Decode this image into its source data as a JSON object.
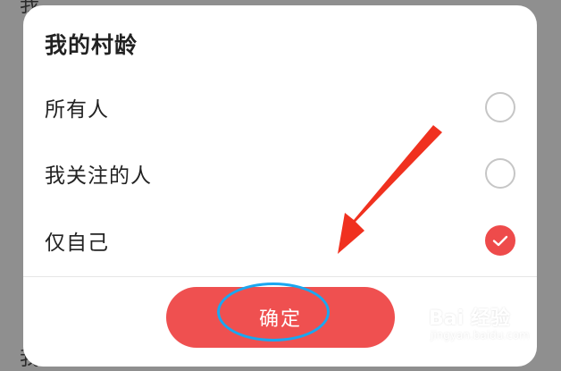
{
  "background": {
    "top_text": "我",
    "bottom_text": "我的作本候顾紧"
  },
  "dialog": {
    "title": "我的村龄",
    "options": [
      {
        "label": "所有人",
        "selected": false
      },
      {
        "label": "我关注的人",
        "selected": false
      },
      {
        "label": "仅自己",
        "selected": true
      }
    ],
    "confirm_label": "确定"
  },
  "annotations": {
    "arrow_color": "#f0311f",
    "circle_color": "#1aa7f0",
    "arrow_target": "confirm-button"
  },
  "watermark": {
    "text": "Bai 经验",
    "sub_text": "jingyan.baidu.com"
  },
  "colors": {
    "accent": "#ef5050",
    "check": "#ee4b4b"
  }
}
